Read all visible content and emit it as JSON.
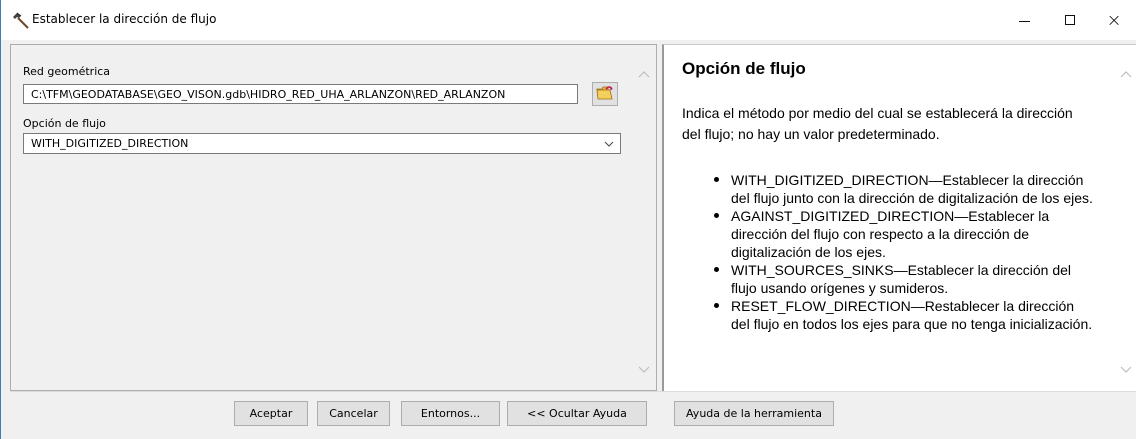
{
  "window": {
    "title": "Establecer la dirección de flujo",
    "icon": "hammer-icon",
    "controls": {
      "minimize": "minimize-icon",
      "maximize": "maximize-icon",
      "close": "×"
    }
  },
  "form": {
    "network_label": "Red geométrica",
    "network_value": "C:\\TFM\\GEODATABASE\\GEO_VISON.gdb\\HIDRO_RED_UHA_ARLANZON\\RED_ARLANZON",
    "browse_icon": "folder-open-icon",
    "flow_option_label": "Opción de flujo",
    "flow_option_value": "WITH_DIGITIZED_DIRECTION"
  },
  "help": {
    "title": "Opción de flujo",
    "description": "Indica el método por medio del cual se establecerá la dirección del flujo; no hay un valor predeterminado.",
    "items": [
      "WITH_DIGITIZED_DIRECTION—Establecer la dirección del flujo junto con la dirección de digitalización de los ejes.",
      "AGAINST_DIGITIZED_DIRECTION—Establecer la dirección del flujo con respecto a la dirección de digitalización de los ejes.",
      "WITH_SOURCES_SINKS—Establecer la dirección del flujo usando orígenes y sumideros.",
      "RESET_FLOW_DIRECTION—Restablecer la dirección del flujo en todos los ejes para que no tenga inicialización."
    ]
  },
  "buttons": {
    "ok": "Aceptar",
    "cancel": "Cancelar",
    "environments": "Entornos...",
    "hide_help": "<< Ocultar Ayuda",
    "tool_help": "Ayuda de la herramienta"
  },
  "colors": {
    "background": "#f0f0f0",
    "button_face": "#e1e1e1",
    "window_border": "#3c7fb1"
  }
}
